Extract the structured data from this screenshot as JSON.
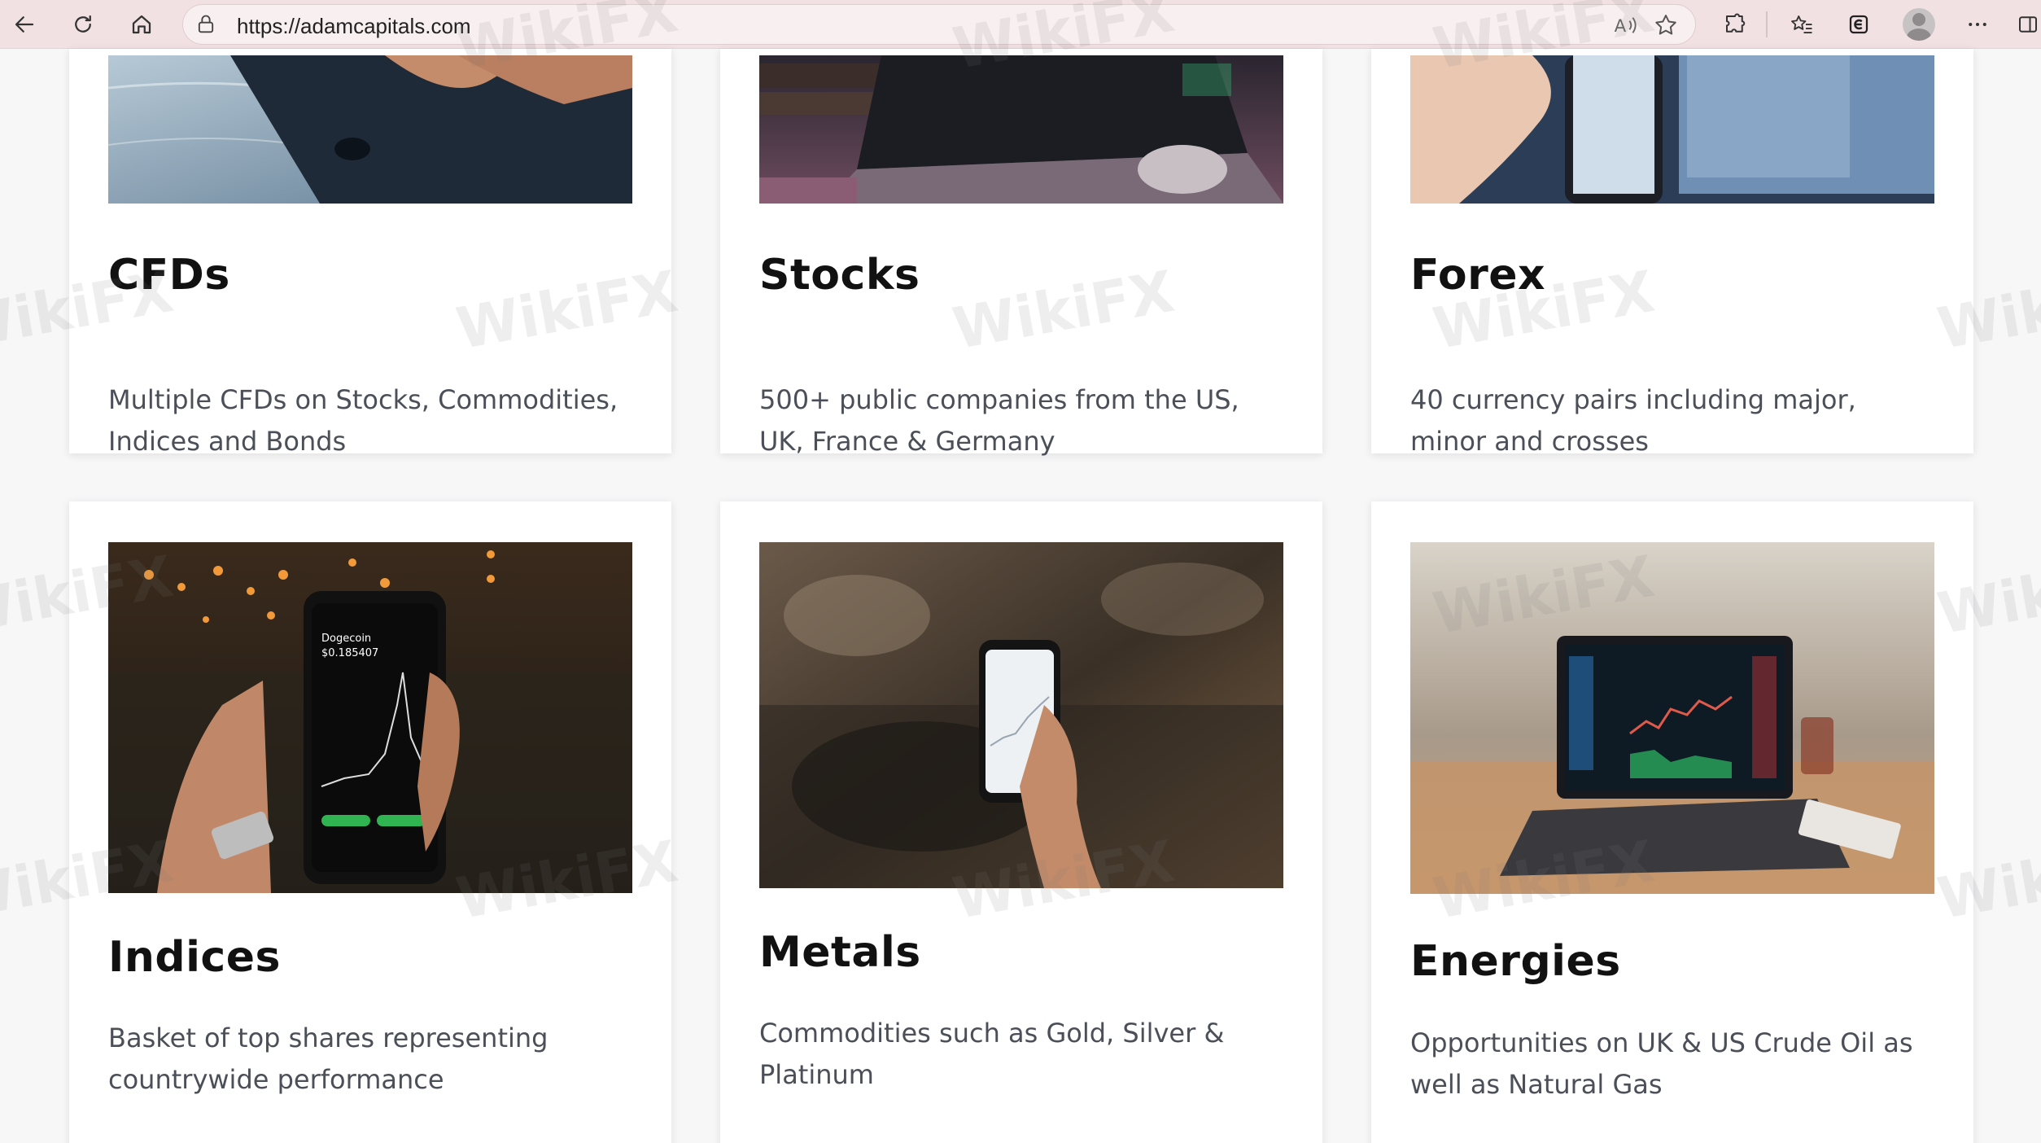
{
  "browser": {
    "url": "https://adamcapitals.com"
  },
  "watermark": "WikiFX",
  "cards": [
    {
      "title": "CFDs",
      "description": "Multiple CFDs on Stocks, Commodities, Indices and Bonds",
      "image_icon": "tablet-on-marble-photo"
    },
    {
      "title": "Stocks",
      "description": "500+ public companies from the US, UK, France & Germany",
      "image_icon": "laptop-and-books-photo"
    },
    {
      "title": "Forex",
      "description": "40 currency pairs including major, minor and crosses",
      "image_icon": "phone-trading-screens-photo"
    },
    {
      "title": "Indices",
      "description": "Basket of top shares representing countrywide performance",
      "image_icon": "hand-holding-phone-dogecoin-photo",
      "phone_text": {
        "label": "Dogecoin",
        "price": "$0.185407"
      }
    },
    {
      "title": "Metals",
      "description": "Commodities such as Gold, Silver & Platinum",
      "image_icon": "hand-holding-phone-cafe-photo"
    },
    {
      "title": "Energies",
      "description": "Opportunities on UK & US Crude Oil as well as Natural Gas",
      "image_icon": "laptop-trading-chart-photo"
    }
  ]
}
